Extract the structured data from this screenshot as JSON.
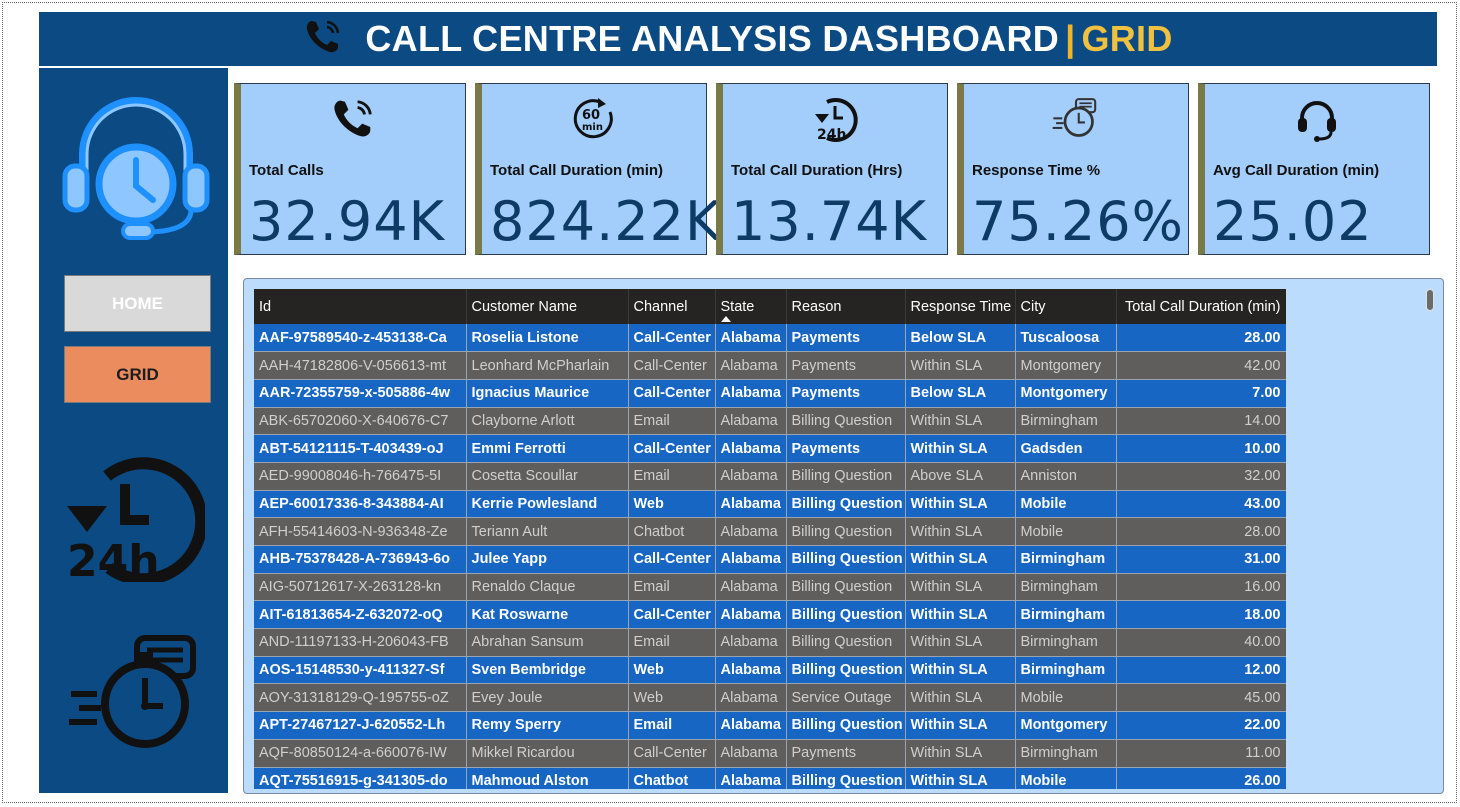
{
  "banner": {
    "title_main": "CALL CENTRE ANALYSIS DASHBOARD",
    "separator": "|",
    "title_accent": "GRID",
    "icon": "phone-ring-icon"
  },
  "nav": {
    "home_label": "HOME",
    "grid_label": "GRID"
  },
  "sidebar_icons": [
    "headset-clock-icon",
    "24h-clock-icon",
    "stopwatch-chat-icon"
  ],
  "kpis": [
    {
      "icon": "phone-ring-icon",
      "label": "Total Calls",
      "value": "32.94K"
    },
    {
      "icon": "60-min-timer-icon",
      "label": "Total Call Duration (min)",
      "value": "824.22K"
    },
    {
      "icon": "24h-clock-icon",
      "label": "Total Call Duration (Hrs)",
      "value": "13.74K"
    },
    {
      "icon": "stopwatch-chat-icon",
      "label": "Response Time %",
      "value": "75.26%"
    },
    {
      "icon": "headset-icon",
      "label": "Avg Call Duration (min)",
      "value": "25.02"
    }
  ],
  "table": {
    "headers": [
      "Id",
      "Customer Name",
      "Channel",
      "State",
      "Reason",
      "Response Time",
      "City",
      "Total Call Duration (min)"
    ],
    "sorted_column": "State",
    "rows": [
      [
        "AAF-97589540-z-453138-Ca",
        "Roselia Listone",
        "Call-Center",
        "Alabama",
        "Payments",
        "Below SLA",
        "Tuscaloosa",
        "28.00"
      ],
      [
        "AAH-47182806-V-056613-mt",
        "Leonhard McPharlain",
        "Call-Center",
        "Alabama",
        "Payments",
        "Within SLA",
        "Montgomery",
        "42.00"
      ],
      [
        "AAR-72355759-x-505886-4w",
        "Ignacius Maurice",
        "Call-Center",
        "Alabama",
        "Payments",
        "Below SLA",
        "Montgomery",
        "7.00"
      ],
      [
        "ABK-65702060-X-640676-C7",
        "Clayborne Arlott",
        "Email",
        "Alabama",
        "Billing Question",
        "Within SLA",
        "Birmingham",
        "14.00"
      ],
      [
        "ABT-54121115-T-403439-oJ",
        "Emmi Ferrotti",
        "Call-Center",
        "Alabama",
        "Payments",
        "Within SLA",
        "Gadsden",
        "10.00"
      ],
      [
        "AED-99008046-h-766475-5I",
        "Cosetta Scoullar",
        "Email",
        "Alabama",
        "Billing Question",
        "Above SLA",
        "Anniston",
        "32.00"
      ],
      [
        "AEP-60017336-8-343884-AI",
        "Kerrie Powlesland",
        "Web",
        "Alabama",
        "Billing Question",
        "Within SLA",
        "Mobile",
        "43.00"
      ],
      [
        "AFH-55414603-N-936348-Ze",
        "Teriann Ault",
        "Chatbot",
        "Alabama",
        "Billing Question",
        "Within SLA",
        "Mobile",
        "28.00"
      ],
      [
        "AHB-75378428-A-736943-6o",
        "Julee Yapp",
        "Call-Center",
        "Alabama",
        "Billing Question",
        "Within SLA",
        "Birmingham",
        "31.00"
      ],
      [
        "AIG-50712617-X-263128-kn",
        "Renaldo Claque",
        "Email",
        "Alabama",
        "Billing Question",
        "Within SLA",
        "Birmingham",
        "16.00"
      ],
      [
        "AIT-61813654-Z-632072-oQ",
        "Kat Roswarne",
        "Call-Center",
        "Alabama",
        "Billing Question",
        "Within SLA",
        "Birmingham",
        "18.00"
      ],
      [
        "AND-11197133-H-206043-FB",
        "Abrahan Sansum",
        "Email",
        "Alabama",
        "Billing Question",
        "Within SLA",
        "Birmingham",
        "40.00"
      ],
      [
        "AOS-15148530-y-411327-Sf",
        "Sven Bembridge",
        "Web",
        "Alabama",
        "Billing Question",
        "Within SLA",
        "Birmingham",
        "12.00"
      ],
      [
        "AOY-31318129-Q-195755-oZ",
        "Evey Joule",
        "Web",
        "Alabama",
        "Service Outage",
        "Within SLA",
        "Mobile",
        "45.00"
      ],
      [
        "APT-27467127-J-620552-Lh",
        "Remy Sperry",
        "Email",
        "Alabama",
        "Billing Question",
        "Within SLA",
        "Montgomery",
        "22.00"
      ],
      [
        "AQF-80850124-a-660076-IW",
        "Mikkel Ricardou",
        "Call-Center",
        "Alabama",
        "Payments",
        "Within SLA",
        "Birmingham",
        "11.00"
      ],
      [
        "AQT-75516915-g-341305-do",
        "Mahmoud Alston",
        "Chatbot",
        "Alabama",
        "Billing Question",
        "Within SLA",
        "Mobile",
        "26.00"
      ]
    ]
  },
  "colors": {
    "navy": "#0b4a82",
    "accent_gold": "#f0c040",
    "kpi_bg": "#a3cdfb",
    "row_blue": "#1766c4",
    "row_gray": "#605e5c",
    "grid_button": "#eb8c5f",
    "home_button": "#d9d9d9"
  }
}
